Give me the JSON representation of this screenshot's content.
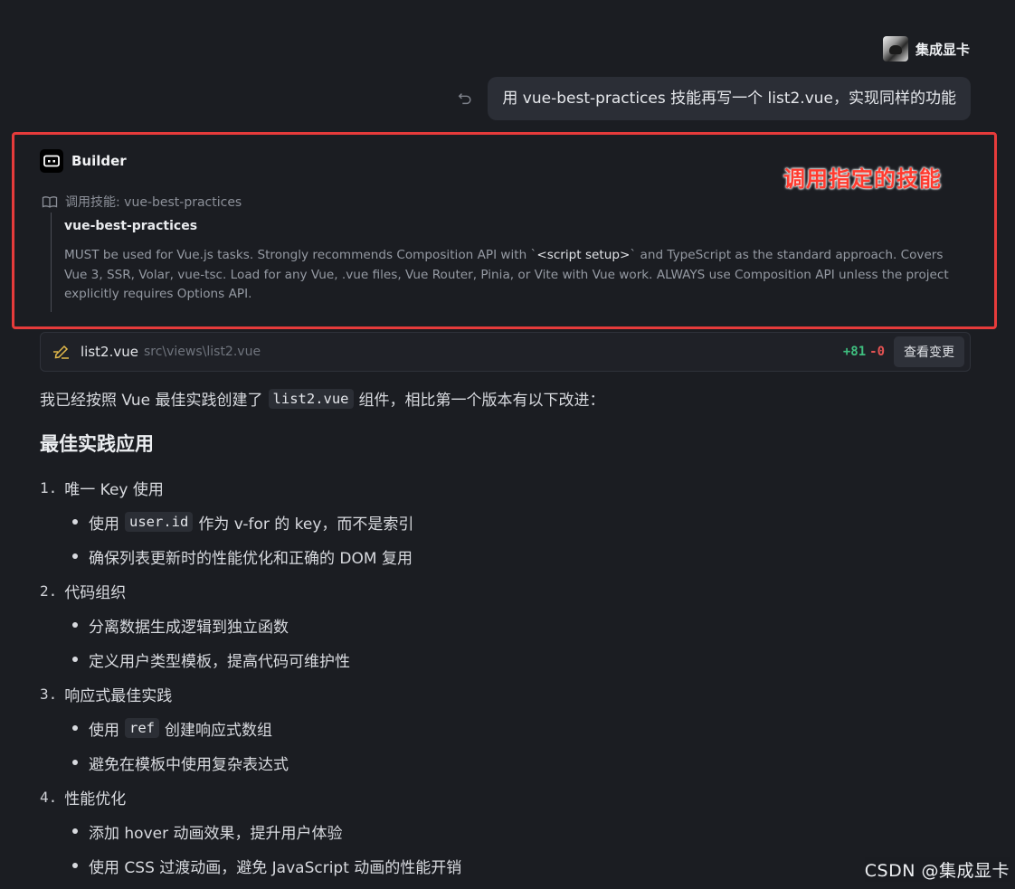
{
  "user": {
    "name": "集成显卡"
  },
  "message": {
    "text": "用 vue-best-practices 技能再写一个 list2.vue，实现同样的功能"
  },
  "builder": {
    "name": "Builder",
    "annotation": "调用指定的技能",
    "skill_label": "调用技能: vue-best-practices",
    "skill_name": "vue-best-practices",
    "skill_desc_1": "MUST be used for Vue.js tasks. Strongly recommends Composition API with `",
    "skill_desc_code": "<script setup>",
    "skill_desc_2": "` and TypeScript as the standard approach. Covers Vue 3, SSR, Volar, vue-tsc. Load for any Vue, .vue files, Vue Router, Pinia, or Vite with Vue work. ALWAYS use Composition API unless the project explicitly requires Options API."
  },
  "file_change": {
    "file_name": "list2.vue",
    "file_path": "src\\views\\list2.vue",
    "additions": "+81",
    "deletions": "-0",
    "view_button": "查看变更"
  },
  "content": {
    "intro_before": "我已经按照 Vue 最佳实践创建了",
    "intro_code": "list2.vue",
    "intro_after": "组件，相比第一个版本有以下改进：",
    "section_title": "最佳实践应用",
    "items": [
      {
        "num": "1.",
        "title": "唯一 Key 使用",
        "b1_before": "使用",
        "b1_code": "user.id",
        "b1_after": "作为 v-for 的 key，而不是索引",
        "b2": "确保列表更新时的性能优化和正确的 DOM 复用"
      },
      {
        "num": "2.",
        "title": "代码组织",
        "b1": "分离数据生成逻辑到独立函数",
        "b2": "定义用户类型模板，提高代码可维护性"
      },
      {
        "num": "3.",
        "title": "响应式最佳实践",
        "b1_before": "使用",
        "b1_code": "ref",
        "b1_after": "创建响应式数组",
        "b2": "避免在模板中使用复杂表达式"
      },
      {
        "num": "4.",
        "title": "性能优化",
        "b1": "添加 hover 动画效果，提升用户体验",
        "b2": "使用 CSS 过渡动画，避免 JavaScript 动画的性能开销"
      }
    ]
  },
  "watermark": "CSDN @集成显卡"
}
